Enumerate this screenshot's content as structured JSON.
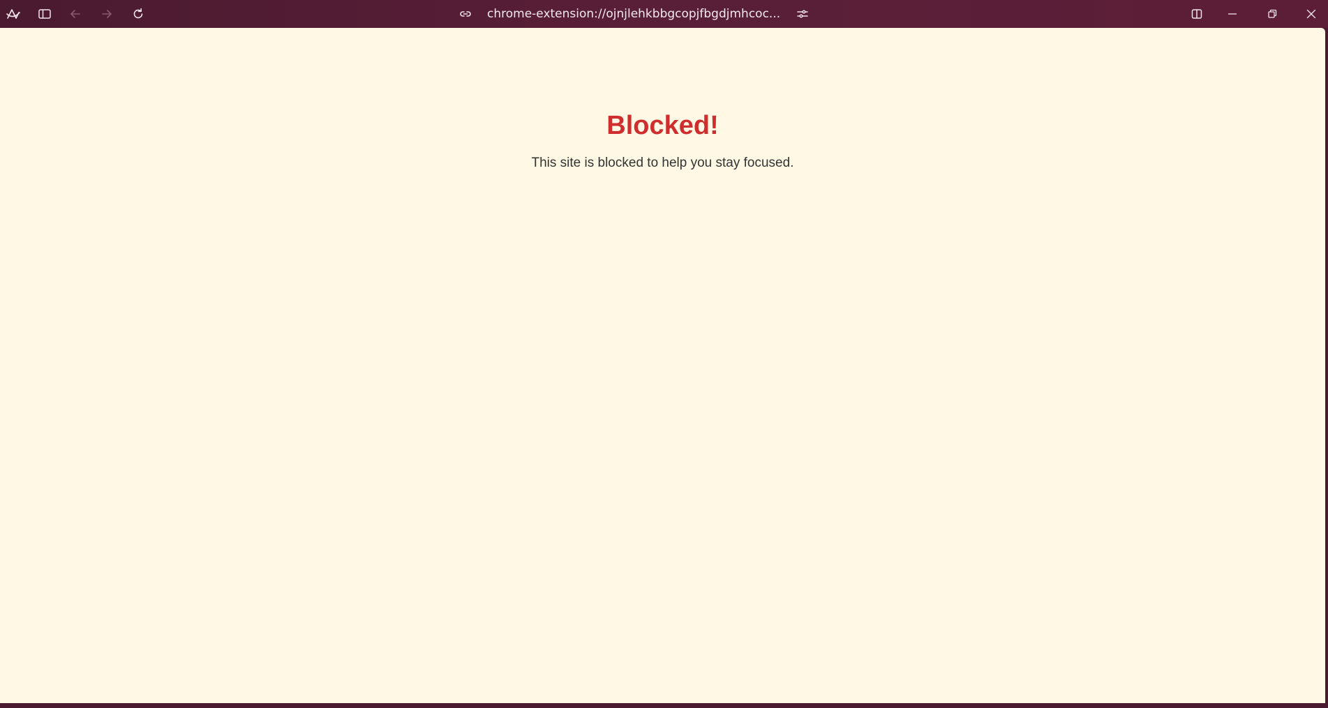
{
  "browser": {
    "address_bar": {
      "url": "chrome-extension://ojnjlehkbbgcopjfbgdjmhcoc..."
    },
    "icons": {
      "app_logo": "arc-logo-icon",
      "sidebar_toggle": "sidebar-toggle-icon",
      "back": "arrow-left-icon",
      "forward": "arrow-right-icon",
      "reload": "reload-icon",
      "link": "link-icon",
      "site_controls": "sliders-icon",
      "split_view": "split-view-icon",
      "minimize": "minimize-icon",
      "restore": "restore-icon",
      "close": "close-icon"
    },
    "colors": {
      "titlebar": "#4a1a30",
      "titlebar_text": "#f3e8ed",
      "disabled_icon": "#8a5a6e"
    }
  },
  "page": {
    "title": "Blocked!",
    "message": "This site is blocked to help you stay focused.",
    "colors": {
      "background": "#fff8e5",
      "title": "#cf2e2e",
      "message": "#333333"
    }
  }
}
